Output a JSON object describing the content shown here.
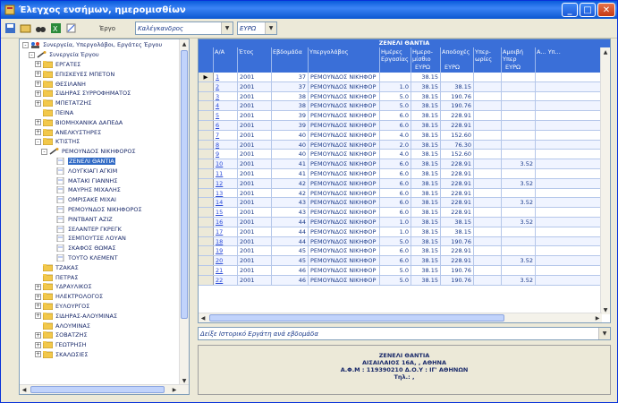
{
  "window": {
    "title": "Έλεγχος ενσήμων, ημερομισθίων"
  },
  "toolbar": {
    "filter_label": "Έργο",
    "combo1_value": "Καλέγκανδρος",
    "combo2_value": "ΕΥΡΩ"
  },
  "tree": {
    "nodes": [
      {
        "level": 0,
        "expander": "-",
        "icon": "group",
        "label": "Συνεργεία, Υπεργολάβοι, Εργάτες Έργου"
      },
      {
        "level": 1,
        "expander": "-",
        "icon": "tools",
        "label": "Συνεργεία Έργου"
      },
      {
        "level": 2,
        "expander": "+",
        "icon": "folder",
        "label": "ΕΡΓΑΤΕΣ"
      },
      {
        "level": 2,
        "expander": "+",
        "icon": "folder",
        "label": "ΕΠΙΣΚΕΥΕΣ ΜΠΕΤΟΝ"
      },
      {
        "level": 2,
        "expander": "+",
        "icon": "folder",
        "label": "ΘΕΣΙΛΑΝΗ"
      },
      {
        "level": 2,
        "expander": "+",
        "icon": "folder",
        "label": "ΣΙΔΗΡΑΣ ΣΥΡΡΟΦΗΜΑΤΟΣ"
      },
      {
        "level": 2,
        "expander": "+",
        "icon": "folder",
        "label": "ΜΠΕΤΑΤΖΗΣ"
      },
      {
        "level": 2,
        "expander": "",
        "icon": "folder",
        "label": "ΠΕΙΝΑ"
      },
      {
        "level": 2,
        "expander": "+",
        "icon": "folder",
        "label": "ΒΙΟΜΗΧΑΝΙΚΑ ΔΑΠΕΔΑ"
      },
      {
        "level": 2,
        "expander": "+",
        "icon": "folder",
        "label": "ΑΝΕΛΚΥΣΤΗΡΕΣ"
      },
      {
        "level": 2,
        "expander": "-",
        "icon": "folder",
        "label": "ΚΤΙΣΤΗΣ"
      },
      {
        "level": 3,
        "expander": "-",
        "icon": "tools",
        "label": "ΡΕΜΟΥΝΔΟΣ ΝΙΚΗΦΟΡΟΣ"
      },
      {
        "level": 4,
        "expander": "",
        "icon": "page",
        "label": "ΖΕΝΕΛΙ ΘΑΝΤΙΑ",
        "selected": true
      },
      {
        "level": 4,
        "expander": "",
        "icon": "page",
        "label": "ΛΟΥΓΚΙΑΓΙ ΑΓΚΙΜ"
      },
      {
        "level": 4,
        "expander": "",
        "icon": "page",
        "label": "ΜΑΤΑΚΙ ΓΙΑΝΝΗΣ"
      },
      {
        "level": 4,
        "expander": "",
        "icon": "page",
        "label": "ΜΑΥΡΗΣ ΜΙΧΑΛΗΣ"
      },
      {
        "level": 4,
        "expander": "",
        "icon": "page",
        "label": "ΟΜΡΙΣΑΚΕ ΜΙΧΑΙ"
      },
      {
        "level": 4,
        "expander": "",
        "icon": "page",
        "label": "ΡΕΜΟΥΝΔΟΣ ΝΙΚΗΦΟΡΟΣ"
      },
      {
        "level": 4,
        "expander": "",
        "icon": "page",
        "label": "ΡΙΝΤΒΑΝΤ ΑΖΙΖ"
      },
      {
        "level": 4,
        "expander": "",
        "icon": "page",
        "label": "ΣΕΛΑΝΤΕΡ ΓΚΡΕΓΚ"
      },
      {
        "level": 4,
        "expander": "",
        "icon": "page",
        "label": "ΣΕΜΠΟΥΤΣΕ ΛΟΥΑΝ"
      },
      {
        "level": 4,
        "expander": "",
        "icon": "page",
        "label": "ΣΚΑΦΟΣ ΘΩΜΑΣ"
      },
      {
        "level": 4,
        "expander": "",
        "icon": "page",
        "label": "ΤΟΥΤΟ ΚΛΕΜΕΝΤ"
      },
      {
        "level": 2,
        "expander": "",
        "icon": "folder",
        "label": "ΤΖΑΚΑΣ"
      },
      {
        "level": 2,
        "expander": "",
        "icon": "folder",
        "label": "ΠΕΤΡΑΣ"
      },
      {
        "level": 2,
        "expander": "+",
        "icon": "folder",
        "label": "ΥΔΡΑΥΛΙΚΟΣ"
      },
      {
        "level": 2,
        "expander": "+",
        "icon": "folder",
        "label": "ΗΛΕΚΤΡΟΛΟΓΟΣ"
      },
      {
        "level": 2,
        "expander": "+",
        "icon": "folder",
        "label": "ΕΥΛΟΥΡΓΟΣ"
      },
      {
        "level": 2,
        "expander": "+",
        "icon": "folder",
        "label": "ΣΙΔΗΡΑΣ-ΑΛΟΥΜΙΝΑΣ"
      },
      {
        "level": 2,
        "expander": "",
        "icon": "folder",
        "label": "ΑΛΟΥΜΙΝΑΣ"
      },
      {
        "level": 2,
        "expander": "+",
        "icon": "folder",
        "label": "ΣΟΒΑΤΖΗΣ"
      },
      {
        "level": 2,
        "expander": "+",
        "icon": "folder",
        "label": "ΓΕΩΤΡΗΣΗ"
      },
      {
        "level": 2,
        "expander": "+",
        "icon": "folder",
        "label": "ΣΚΑΛΩΣΙΕΣ"
      }
    ]
  },
  "grid": {
    "title": "ΖΕΝΕΛΙ ΘΑΝΤΙΑ",
    "headers": [
      {
        "label": "",
        "unit": ""
      },
      {
        "label": "Α/Α",
        "unit": ""
      },
      {
        "label": "Έτος",
        "unit": ""
      },
      {
        "label": "Εβδομάδα",
        "unit": ""
      },
      {
        "label": "Υπεργολάβος",
        "unit": ""
      },
      {
        "label": "Ημέρες Εργασίας",
        "unit": ""
      },
      {
        "label": "Ημερο-μίσθιο",
        "unit": "ΕΥΡΩ"
      },
      {
        "label": "Αποδοχές",
        "unit": "ΕΥΡΩ"
      },
      {
        "label": "Υπερ-ωρίες",
        "unit": ""
      },
      {
        "label": "Αμοιβή Υπερ",
        "unit": "ΕΥΡΩ"
      },
      {
        "label": "Α... Υπ...",
        "unit": ""
      }
    ],
    "rows": [
      {
        "marker": "▶",
        "aa": "1",
        "year": "2001",
        "week": "37",
        "sub": "ΡΕΜΟΥΝΔΟΣ ΝΙΚΗΦΟΡ",
        "days": "",
        "wage": "38.15",
        "pay": "",
        "ot": "",
        "otpay": ""
      },
      {
        "marker": "",
        "aa": "2",
        "year": "2001",
        "week": "37",
        "sub": "ΡΕΜΟΥΝΔΟΣ ΝΙΚΗΦΟΡ",
        "days": "1.0",
        "wage": "38.15",
        "pay": "38.15",
        "ot": "",
        "otpay": ""
      },
      {
        "marker": "",
        "aa": "3",
        "year": "2001",
        "week": "38",
        "sub": "ΡΕΜΟΥΝΔΟΣ ΝΙΚΗΦΟΡ",
        "days": "5.0",
        "wage": "38.15",
        "pay": "190.76",
        "ot": "",
        "otpay": ""
      },
      {
        "marker": "",
        "aa": "4",
        "year": "2001",
        "week": "38",
        "sub": "ΡΕΜΟΥΝΔΟΣ ΝΙΚΗΦΟΡ",
        "days": "5.0",
        "wage": "38.15",
        "pay": "190.76",
        "ot": "",
        "otpay": ""
      },
      {
        "marker": "",
        "aa": "5",
        "year": "2001",
        "week": "39",
        "sub": "ΡΕΜΟΥΝΔΟΣ ΝΙΚΗΦΟΡ",
        "days": "6.0",
        "wage": "38.15",
        "pay": "228.91",
        "ot": "",
        "otpay": ""
      },
      {
        "marker": "",
        "aa": "6",
        "year": "2001",
        "week": "39",
        "sub": "ΡΕΜΟΥΝΔΟΣ ΝΙΚΗΦΟΡ",
        "days": "6.0",
        "wage": "38.15",
        "pay": "228.91",
        "ot": "",
        "otpay": ""
      },
      {
        "marker": "",
        "aa": "7",
        "year": "2001",
        "week": "40",
        "sub": "ΡΕΜΟΥΝΔΟΣ ΝΙΚΗΦΟΡ",
        "days": "4.0",
        "wage": "38.15",
        "pay": "152.60",
        "ot": "",
        "otpay": ""
      },
      {
        "marker": "",
        "aa": "8",
        "year": "2001",
        "week": "40",
        "sub": "ΡΕΜΟΥΝΔΟΣ ΝΙΚΗΦΟΡ",
        "days": "2.0",
        "wage": "38.15",
        "pay": "76.30",
        "ot": "",
        "otpay": ""
      },
      {
        "marker": "",
        "aa": "9",
        "year": "2001",
        "week": "40",
        "sub": "ΡΕΜΟΥΝΔΟΣ ΝΙΚΗΦΟΡ",
        "days": "4.0",
        "wage": "38.15",
        "pay": "152.60",
        "ot": "",
        "otpay": ""
      },
      {
        "marker": "",
        "aa": "10",
        "year": "2001",
        "week": "41",
        "sub": "ΡΕΜΟΥΝΔΟΣ ΝΙΚΗΦΟΡ",
        "days": "6.0",
        "wage": "38.15",
        "pay": "228.91",
        "ot": "",
        "otpay": "3.52"
      },
      {
        "marker": "",
        "aa": "11",
        "year": "2001",
        "week": "41",
        "sub": "ΡΕΜΟΥΝΔΟΣ ΝΙΚΗΦΟΡ",
        "days": "6.0",
        "wage": "38.15",
        "pay": "228.91",
        "ot": "",
        "otpay": ""
      },
      {
        "marker": "",
        "aa": "12",
        "year": "2001",
        "week": "42",
        "sub": "ΡΕΜΟΥΝΔΟΣ ΝΙΚΗΦΟΡ",
        "days": "6.0",
        "wage": "38.15",
        "pay": "228.91",
        "ot": "",
        "otpay": "3.52"
      },
      {
        "marker": "",
        "aa": "13",
        "year": "2001",
        "week": "42",
        "sub": "ΡΕΜΟΥΝΔΟΣ ΝΙΚΗΦΟΡ",
        "days": "6.0",
        "wage": "38.15",
        "pay": "228.91",
        "ot": "",
        "otpay": ""
      },
      {
        "marker": "",
        "aa": "14",
        "year": "2001",
        "week": "43",
        "sub": "ΡΕΜΟΥΝΔΟΣ ΝΙΚΗΦΟΡ",
        "days": "6.0",
        "wage": "38.15",
        "pay": "228.91",
        "ot": "",
        "otpay": "3.52"
      },
      {
        "marker": "",
        "aa": "15",
        "year": "2001",
        "week": "43",
        "sub": "ΡΕΜΟΥΝΔΟΣ ΝΙΚΗΦΟΡ",
        "days": "6.0",
        "wage": "38.15",
        "pay": "228.91",
        "ot": "",
        "otpay": ""
      },
      {
        "marker": "",
        "aa": "16",
        "year": "2001",
        "week": "44",
        "sub": "ΡΕΜΟΥΝΔΟΣ ΝΙΚΗΦΟΡ",
        "days": "1.0",
        "wage": "38.15",
        "pay": "38.15",
        "ot": "",
        "otpay": "3.52"
      },
      {
        "marker": "",
        "aa": "17",
        "year": "2001",
        "week": "44",
        "sub": "ΡΕΜΟΥΝΔΟΣ ΝΙΚΗΦΟΡ",
        "days": "1.0",
        "wage": "38.15",
        "pay": "38.15",
        "ot": "",
        "otpay": ""
      },
      {
        "marker": "",
        "aa": "18",
        "year": "2001",
        "week": "44",
        "sub": "ΡΕΜΟΥΝΔΟΣ ΝΙΚΗΦΟΡ",
        "days": "5.0",
        "wage": "38.15",
        "pay": "190.76",
        "ot": "",
        "otpay": ""
      },
      {
        "marker": "",
        "aa": "19",
        "year": "2001",
        "week": "45",
        "sub": "ΡΕΜΟΥΝΔΟΣ ΝΙΚΗΦΟΡ",
        "days": "6.0",
        "wage": "38.15",
        "pay": "228.91",
        "ot": "",
        "otpay": ""
      },
      {
        "marker": "",
        "aa": "20",
        "year": "2001",
        "week": "45",
        "sub": "ΡΕΜΟΥΝΔΟΣ ΝΙΚΗΦΟΡ",
        "days": "6.0",
        "wage": "38.15",
        "pay": "228.91",
        "ot": "",
        "otpay": "3.52"
      },
      {
        "marker": "",
        "aa": "21",
        "year": "2001",
        "week": "46",
        "sub": "ΡΕΜΟΥΝΔΟΣ ΝΙΚΗΦΟΡ",
        "days": "5.0",
        "wage": "38.15",
        "pay": "190.76",
        "ot": "",
        "otpay": ""
      },
      {
        "marker": "",
        "aa": "22",
        "year": "2001",
        "week": "46",
        "sub": "ΡΕΜΟΥΝΔΟΣ ΝΙΚΗΦΟΡ",
        "days": "5.0",
        "wage": "38.15",
        "pay": "190.76",
        "ot": "",
        "otpay": "3.52"
      }
    ]
  },
  "filter": {
    "value": "Δείξε Ιστορικό Εργάτη ανά εβδομάδα"
  },
  "footer": {
    "line1": "ΖΕΝΕΛΙ ΘΑΝΤΙΑ",
    "line2": "ΑΙΣΑΙΛΑΙΟΣ 16Α, , ΑΘΗΝΑ",
    "line3": "Α.Φ.Μ : 119390210  Δ.Ο.Υ : ΙΓ' ΑΘΗΝΩΝ",
    "line4": "Τηλ.: ,"
  },
  "colors": {
    "title_bar": "#0a5bdb",
    "grid_header": "#3a6fd8",
    "selection": "#316ac5"
  }
}
